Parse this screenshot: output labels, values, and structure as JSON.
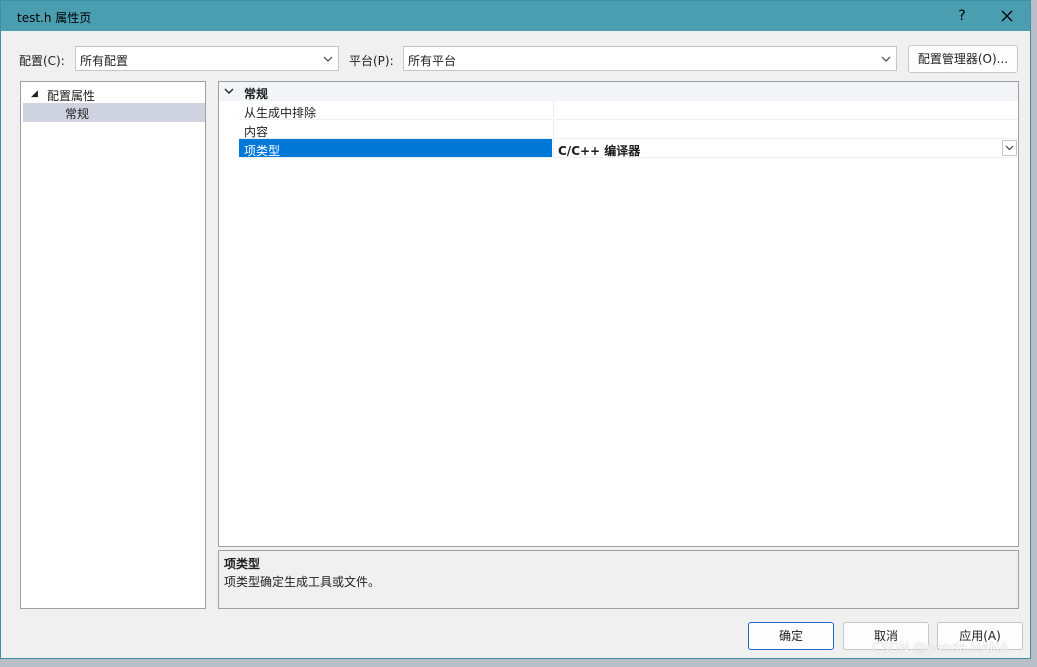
{
  "window": {
    "title": "test.h 属性页",
    "help": "?",
    "close": "✕"
  },
  "toolbar": {
    "config_label": "配置(C):",
    "config_value": "所有配置",
    "platform_label": "平台(P):",
    "platform_value": "所有平台",
    "config_manager": "配置管理器(O)..."
  },
  "tree": {
    "root": "配置属性",
    "child": "常规"
  },
  "grid": {
    "category": "常规",
    "rows": [
      {
        "name": "从生成中排除",
        "value": ""
      },
      {
        "name": "内容",
        "value": ""
      },
      {
        "name": "项类型",
        "value": "C/C++ 编译器"
      }
    ]
  },
  "description": {
    "title": "项类型",
    "text": "项类型确定生成工具或文件。"
  },
  "buttons": {
    "ok": "确定",
    "cancel": "取消",
    "apply": "应用(A)"
  },
  "watermark": "CSDN @panda HAHA",
  "colors": {
    "titlebar": "#4a9eb0",
    "selection": "#0078d7",
    "tree_selection": "#cfd3e0"
  }
}
